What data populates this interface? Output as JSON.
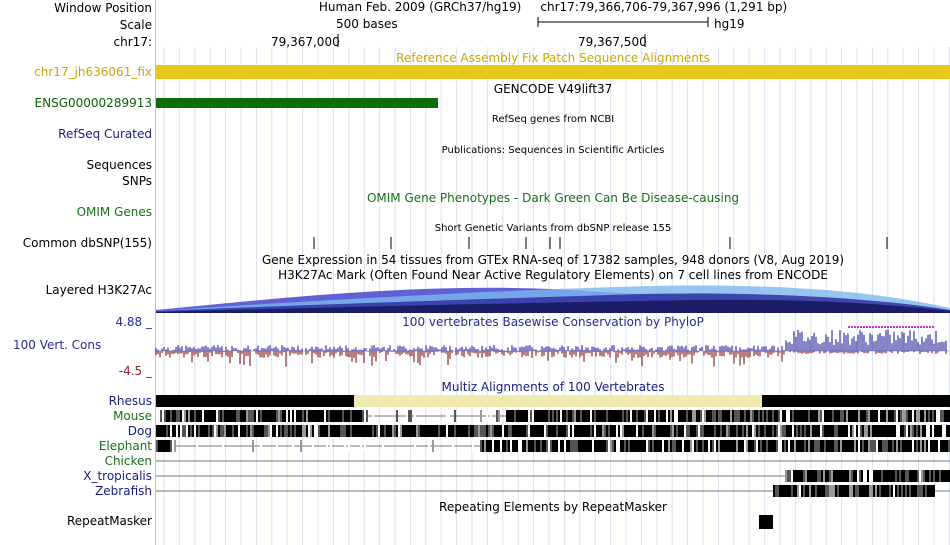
{
  "header": {
    "window_position_label": "Window Position",
    "scale_label": "Scale",
    "chrom_label": "chr17:",
    "assembly": "Human Feb. 2009 (GRCh37/hg19)",
    "position": "chr17:79,366,706-79,367,996 (1,291 bp)",
    "scale_text": "500 bases",
    "db": "hg19",
    "tick1": "79,367,000",
    "tick2": "79,367,500"
  },
  "tracks": {
    "fix_patch": {
      "label": "chr17_jh636061_fix",
      "title": "Reference Assembly Fix Patch Sequence Alignments",
      "color": "#c8a800"
    },
    "gencode": {
      "label": "ENSG00000289913",
      "title": "GENCODE V49lift37",
      "color": "#0a5f0a"
    },
    "refseq": {
      "label": "RefSeq Curated",
      "title": "RefSeq genes from NCBI",
      "color": "#1a1a80"
    },
    "publications": {
      "label": "Sequences",
      "title": "Publications: Sequences in Scientific Articles"
    },
    "snps_label": "SNPs",
    "omim": {
      "label": "OMIM Genes",
      "title": "OMIM Gene Phenotypes - Dark Green Can Be Disease-causing",
      "color": "#1a6e1a"
    },
    "common_snp": {
      "label": "Common dbSNP(155)",
      "title": "Short Genetic Variants from dbSNP release 155"
    },
    "gtex": {
      "title": "Gene Expression in 54 tissues from GTEx RNA-seq of 17382 samples, 948 donors (V8, Aug 2019)"
    },
    "h3k27ac": {
      "label": "Layered H3K27Ac",
      "title": "H3K27Ac Mark (Often Found Near Active Regulatory Elements) on 7 cell lines from ENCODE"
    },
    "cons": {
      "label": "100 Vert. Cons",
      "max": "4.88 _",
      "min": "-4.5 _",
      "title": "100 vertebrates Basewise Conservation by PhyloP",
      "color": "#2a2a90"
    },
    "multiz": {
      "title": "Multiz Alignments of 100 Vertebrates",
      "species": [
        "Rhesus",
        "Mouse",
        "Dog",
        "Elephant",
        "Chicken",
        "X_tropicalis",
        "Zebrafish"
      ]
    },
    "repeatmasker": {
      "label": "RepeatMasker",
      "title": "Repeating Elements by RepeatMasker"
    }
  }
}
